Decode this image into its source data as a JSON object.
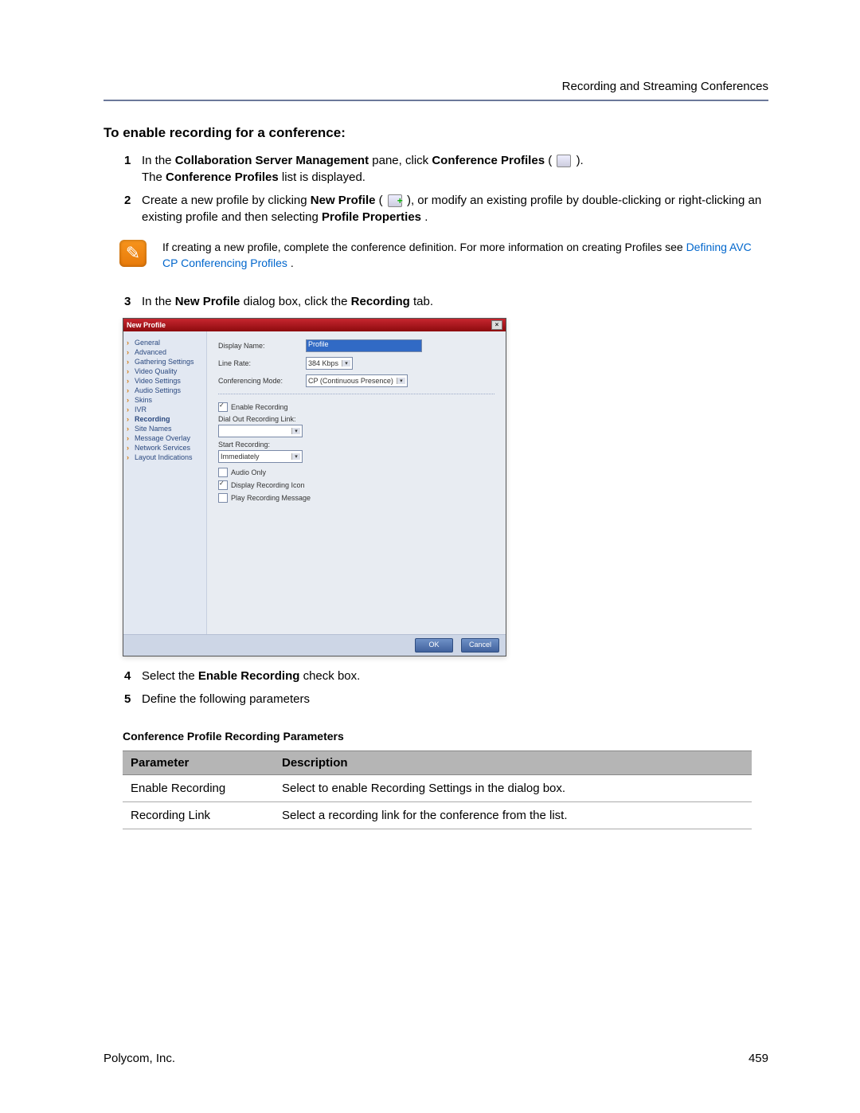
{
  "header": {
    "section": "Recording and Streaming Conferences"
  },
  "title": "To enable recording for a conference:",
  "steps": {
    "s1": {
      "num": "1",
      "text_a": "In the ",
      "bold_a": "Collaboration Server Management",
      "text_b": " pane, click ",
      "bold_b": "Conference Profiles",
      "text_c": " (",
      "text_d": ").",
      "line2_a": "The ",
      "line2_bold": "Conference Profiles",
      "line2_b": " list is displayed."
    },
    "s2": {
      "num": "2",
      "text_a": "Create a new profile by clicking ",
      "bold_a": "New Profile",
      "text_b": " (",
      "text_c": "), or modify an existing profile by double-clicking or right-clicking an existing profile and then selecting ",
      "bold_b": "Profile Properties",
      "text_d": "."
    },
    "s3": {
      "num": "3",
      "text_a": "In the ",
      "bold_a": "New Profile",
      "text_b": " dialog box, click the ",
      "bold_b": "Recording",
      "text_c": " tab."
    },
    "s4": {
      "num": "4",
      "text_a": "Select the ",
      "bold_a": "Enable Recording",
      "text_b": " check box."
    },
    "s5": {
      "num": "5",
      "text_a": "Define the following parameters"
    }
  },
  "note": {
    "text_a": "If creating a new profile, complete the conference definition. For more information on creating Profiles see ",
    "link": "Defining AVC CP Conferencing Profiles",
    "text_b": "."
  },
  "dialog": {
    "title": "New Profile",
    "nav": [
      "General",
      "Advanced",
      "Gathering Settings",
      "Video Quality",
      "Video Settings",
      "Audio Settings",
      "Skins",
      "IVR",
      "Recording",
      "Site Names",
      "Message Overlay",
      "Network Services",
      "Layout Indications"
    ],
    "nav_active_index": 8,
    "fields": {
      "display_name_label": "Display Name:",
      "display_name_value": "Profile",
      "line_rate_label": "Line Rate:",
      "line_rate_value": "384 Kbps",
      "conf_mode_label": "Conferencing Mode:",
      "conf_mode_value": "CP (Continuous Presence)"
    },
    "recording": {
      "enable_label": "Enable Recording",
      "dialout_label": "Dial Out Recording Link:",
      "dialout_value": "",
      "start_label": "Start Recording:",
      "start_value": "Immediately",
      "audio_only_label": "Audio Only",
      "display_icon_label": "Display Recording Icon",
      "play_msg_label": "Play Recording Message"
    },
    "buttons": {
      "ok": "OK",
      "cancel": "Cancel"
    }
  },
  "table": {
    "title": "Conference Profile Recording Parameters",
    "headers": {
      "param": "Parameter",
      "desc": "Description"
    },
    "rows": [
      {
        "param": "Enable Recording",
        "desc": "Select to enable Recording Settings in the dialog box."
      },
      {
        "param": "Recording Link",
        "desc": "Select a recording link for the conference from the list."
      }
    ]
  },
  "footer": {
    "company": "Polycom, Inc.",
    "page": "459"
  }
}
